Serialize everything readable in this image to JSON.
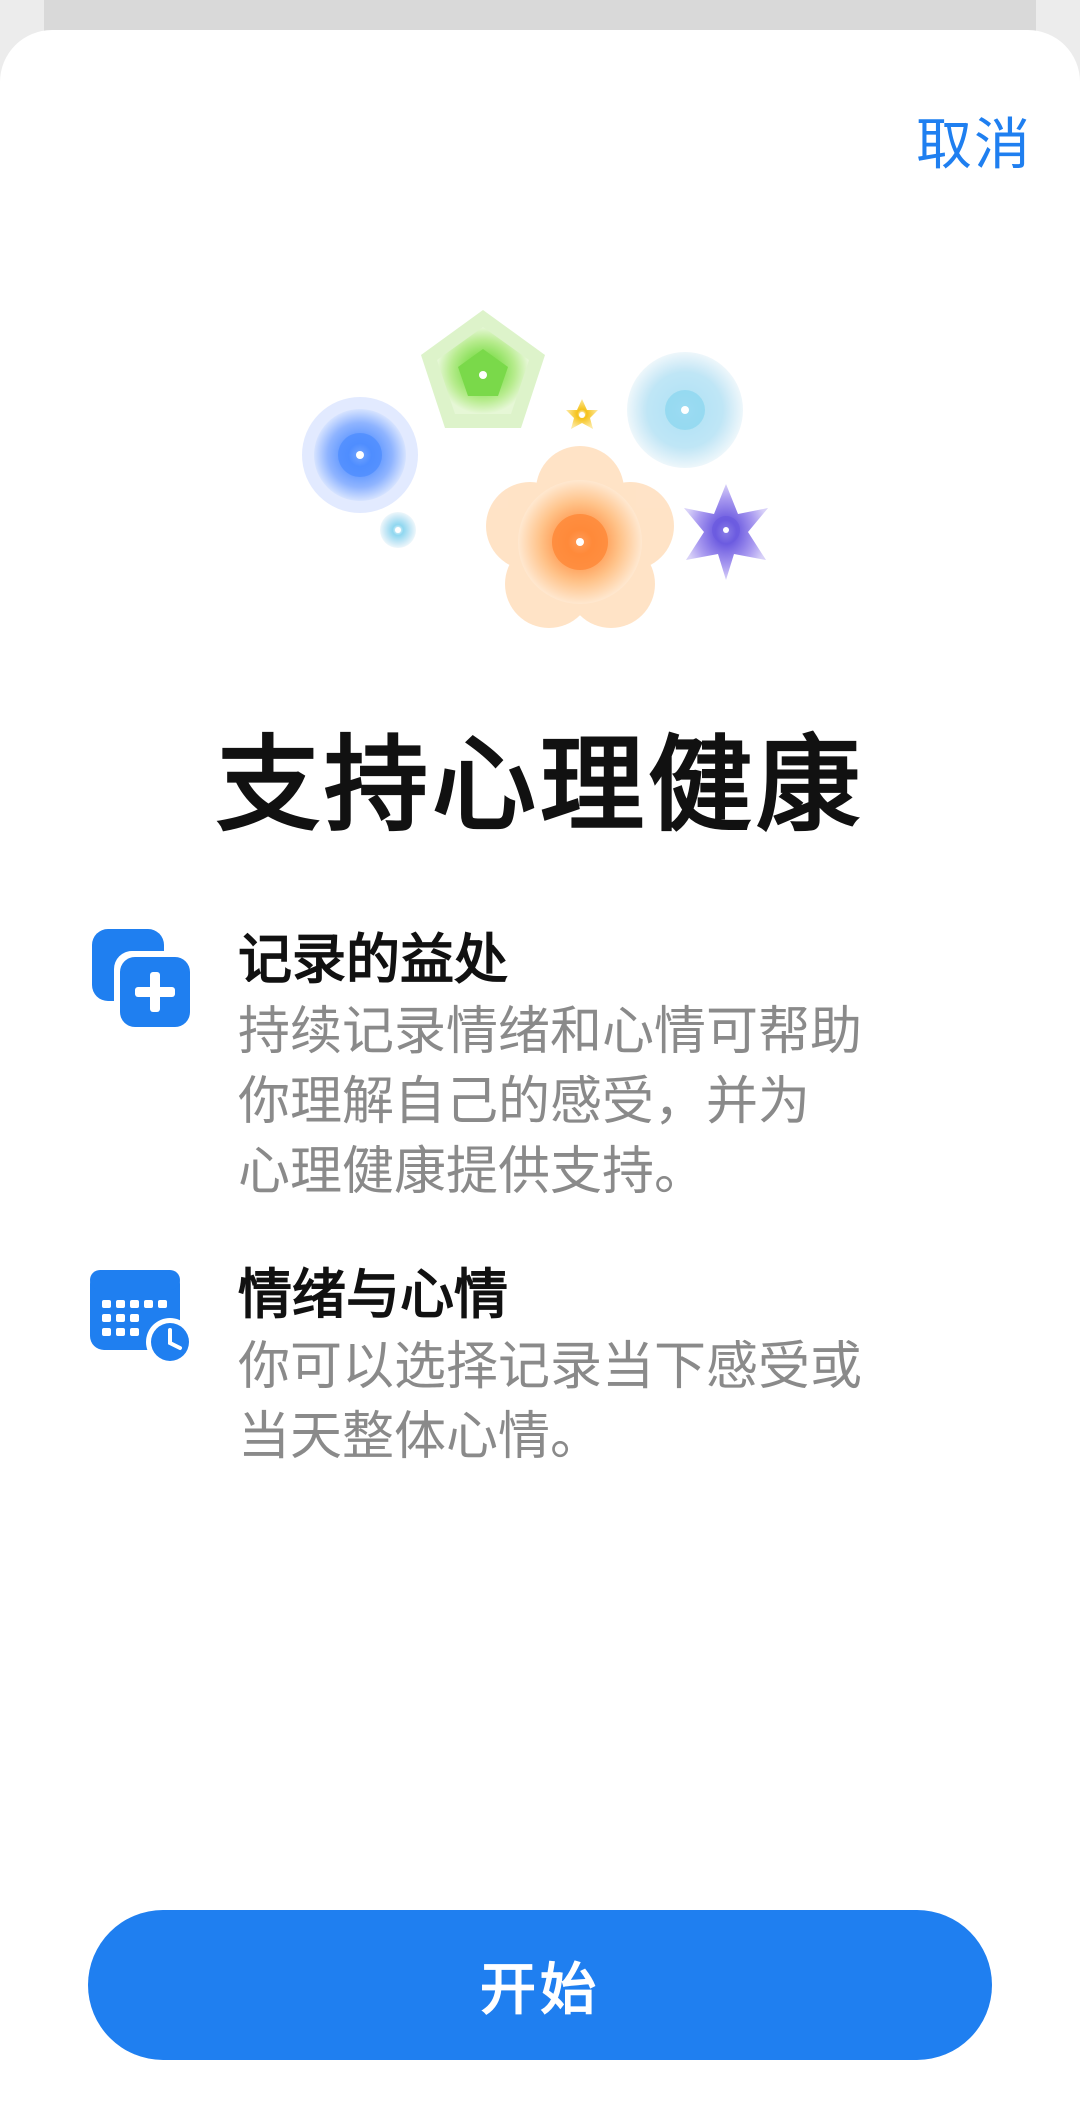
{
  "header": {
    "cancel_label": "取消"
  },
  "hero": {
    "icon": "flowers-illustration"
  },
  "page_title": "支持心理健康",
  "features": [
    {
      "icon": "add-entry-icon",
      "title": "记录的益处",
      "desc_lines": [
        "持续记录情绪和心情可帮助",
        "你理解自己的感受，并为",
        "心理健康提供支持。"
      ]
    },
    {
      "icon": "calendar-clock-icon",
      "title": "情绪与心情",
      "desc_lines": [
        "你可以选择记录当下感受或",
        "当天整体心情。"
      ]
    }
  ],
  "footer": {
    "start_label": "开始"
  },
  "colors": {
    "accent": "#1f7ff0",
    "title": "#111111",
    "secondary_text": "#8a8a8a"
  }
}
